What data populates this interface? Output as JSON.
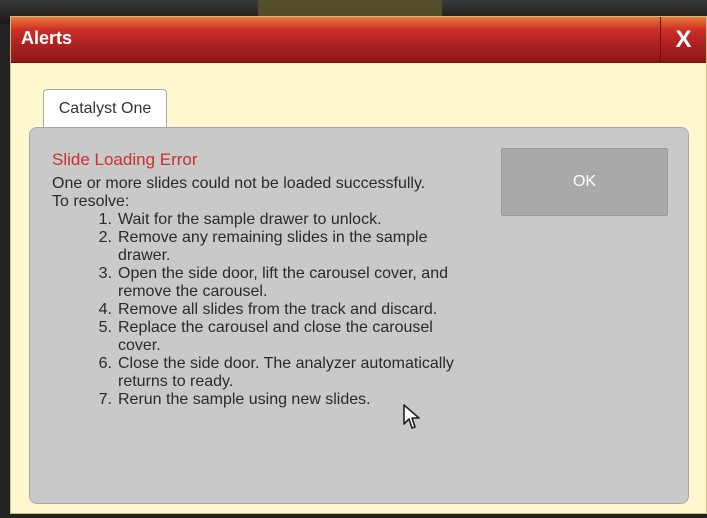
{
  "window": {
    "title": "Alerts",
    "close_label": "X"
  },
  "tabs": [
    {
      "label": "Catalyst One"
    }
  ],
  "alert": {
    "title": "Slide Loading Error",
    "lines": [
      "One or more slides could not be loaded successfully.",
      "To resolve:"
    ],
    "steps": [
      {
        "number": "1.",
        "text": "Wait for the sample drawer to unlock."
      },
      {
        "number": "2.",
        "text": "Remove any remaining slides in the sample drawer."
      },
      {
        "number": "3.",
        "text": "Open the side door, lift the carousel cover, and remove the carousel."
      },
      {
        "number": "4.",
        "text": "Remove all slides from the track and discard."
      },
      {
        "number": "5.",
        "text": "Replace the carousel and close the carousel cover."
      },
      {
        "number": "6.",
        "text": "Close the side door. The analyzer automatically returns to ready."
      },
      {
        "number": "7.",
        "text": "Rerun the sample using new slides."
      }
    ]
  },
  "actions": {
    "ok_label": "OK"
  },
  "icons": {
    "cursor": "pointer-cursor-icon",
    "close": "close-icon"
  },
  "colors": {
    "title_bar": "#aa2323",
    "window_background": "#fff8cf",
    "panel_background": "#c9c9c9",
    "error_text": "#c73131",
    "button_background": "#a9a9a9"
  }
}
